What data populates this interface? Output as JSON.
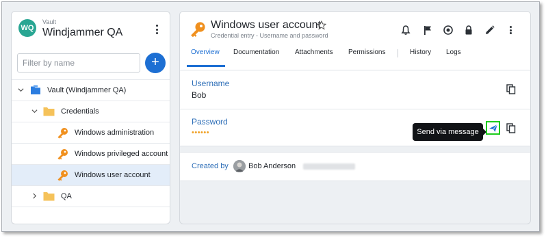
{
  "vault": {
    "avatar_initials": "WQ",
    "type_label": "Vault",
    "name": "Windjammer QA"
  },
  "filter": {
    "placeholder": "Filter by name"
  },
  "add_button": {
    "label": "+"
  },
  "tree": {
    "root": {
      "label": "Vault (Windjammer QA)",
      "icon": "vault-folder-icon"
    },
    "folder_credentials": {
      "label": "Credentials",
      "icon": "folder-icon"
    },
    "entries": [
      {
        "label": "Windows administration",
        "icon": "key-icon"
      },
      {
        "label": "Windows privileged account",
        "icon": "key-icon"
      },
      {
        "label": "Windows user account",
        "icon": "key-icon",
        "selected": true
      }
    ],
    "folder_qa": {
      "label": "QA",
      "icon": "folder-icon"
    }
  },
  "entry": {
    "title": "Windows user account",
    "subtitle": "Credential entry - Username and password"
  },
  "tabs": [
    {
      "label": "Overview",
      "active": true
    },
    {
      "label": "Documentation"
    },
    {
      "label": "Attachments"
    },
    {
      "label": "Permissions"
    },
    {
      "label": "History"
    },
    {
      "label": "Logs"
    }
  ],
  "fields": {
    "username_label": "Username",
    "username_value": "Bob",
    "password_label": "Password",
    "password_mask": "••••••"
  },
  "tooltip": {
    "text": "Send via message"
  },
  "created": {
    "label": "Created by",
    "name": "Bob Anderson"
  },
  "colors": {
    "accent": "#1d6fd3",
    "key": "#f0901e",
    "folder": "#f5c25a",
    "avatar": "#29a693",
    "highlight_border": "#1dcc1d"
  }
}
